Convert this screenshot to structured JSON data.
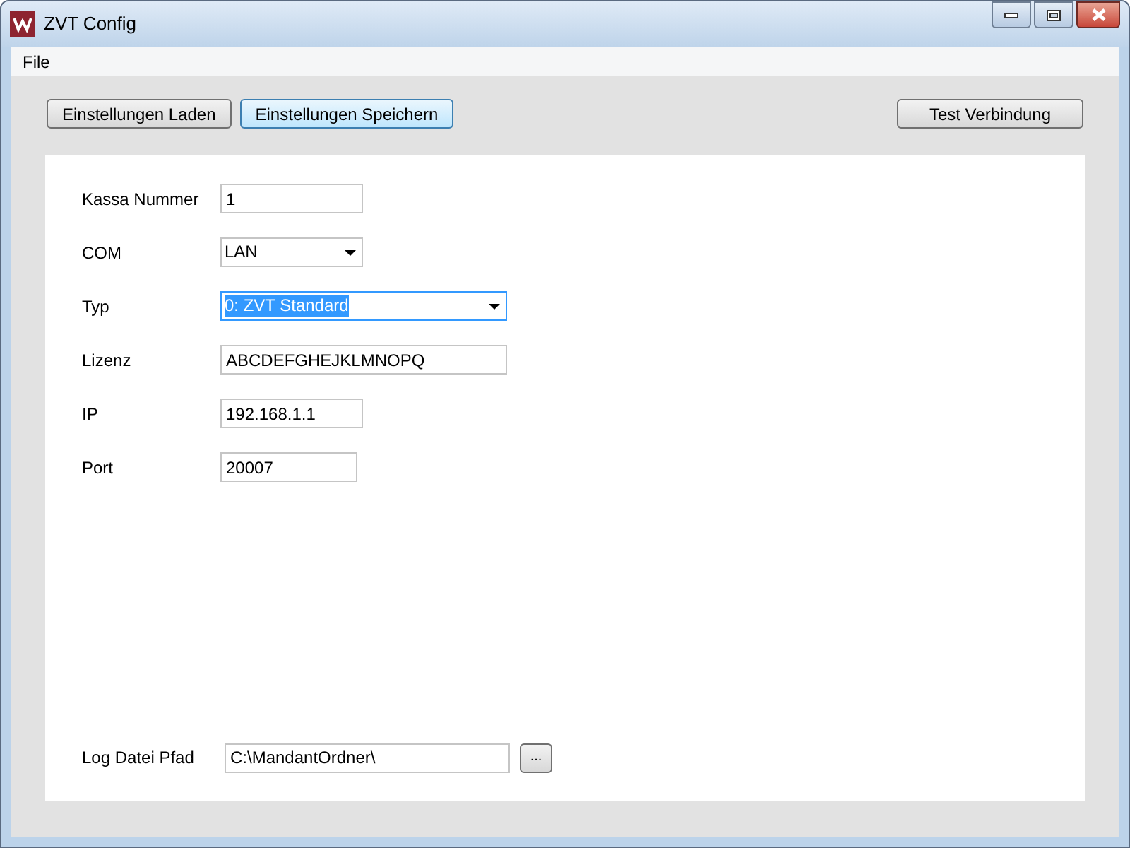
{
  "window": {
    "title": "ZVT Config"
  },
  "menu": [
    "File"
  ],
  "toolbar": [
    {
      "label": "Einstellungen Laden",
      "focused": false
    },
    {
      "label": "Einstellungen Speichern",
      "focused": true
    },
    {
      "label": "Test Verbindung",
      "focused": false
    }
  ],
  "fields": [
    {
      "label": "Kassa Nummer",
      "kind": "text",
      "value": "1",
      "focused": false
    },
    {
      "label": "COM",
      "kind": "select",
      "value": "LAN",
      "focused": false
    },
    {
      "label": "Typ",
      "kind": "select",
      "value": "0: ZVT Standard",
      "focused": true
    },
    {
      "label": "Lizenz",
      "kind": "text",
      "value": "ABCDEFGHEJKLMNOPQ",
      "focused": false
    },
    {
      "label": "IP",
      "kind": "text",
      "value": "192.168.1.1",
      "focused": false
    },
    {
      "label": "Port",
      "kind": "text",
      "value": "20007",
      "focused": false
    }
  ],
  "log_path": {
    "label": "Log Datei Pfad",
    "value": "C:\\MandantOrdner\\",
    "browse_button": "..."
  }
}
